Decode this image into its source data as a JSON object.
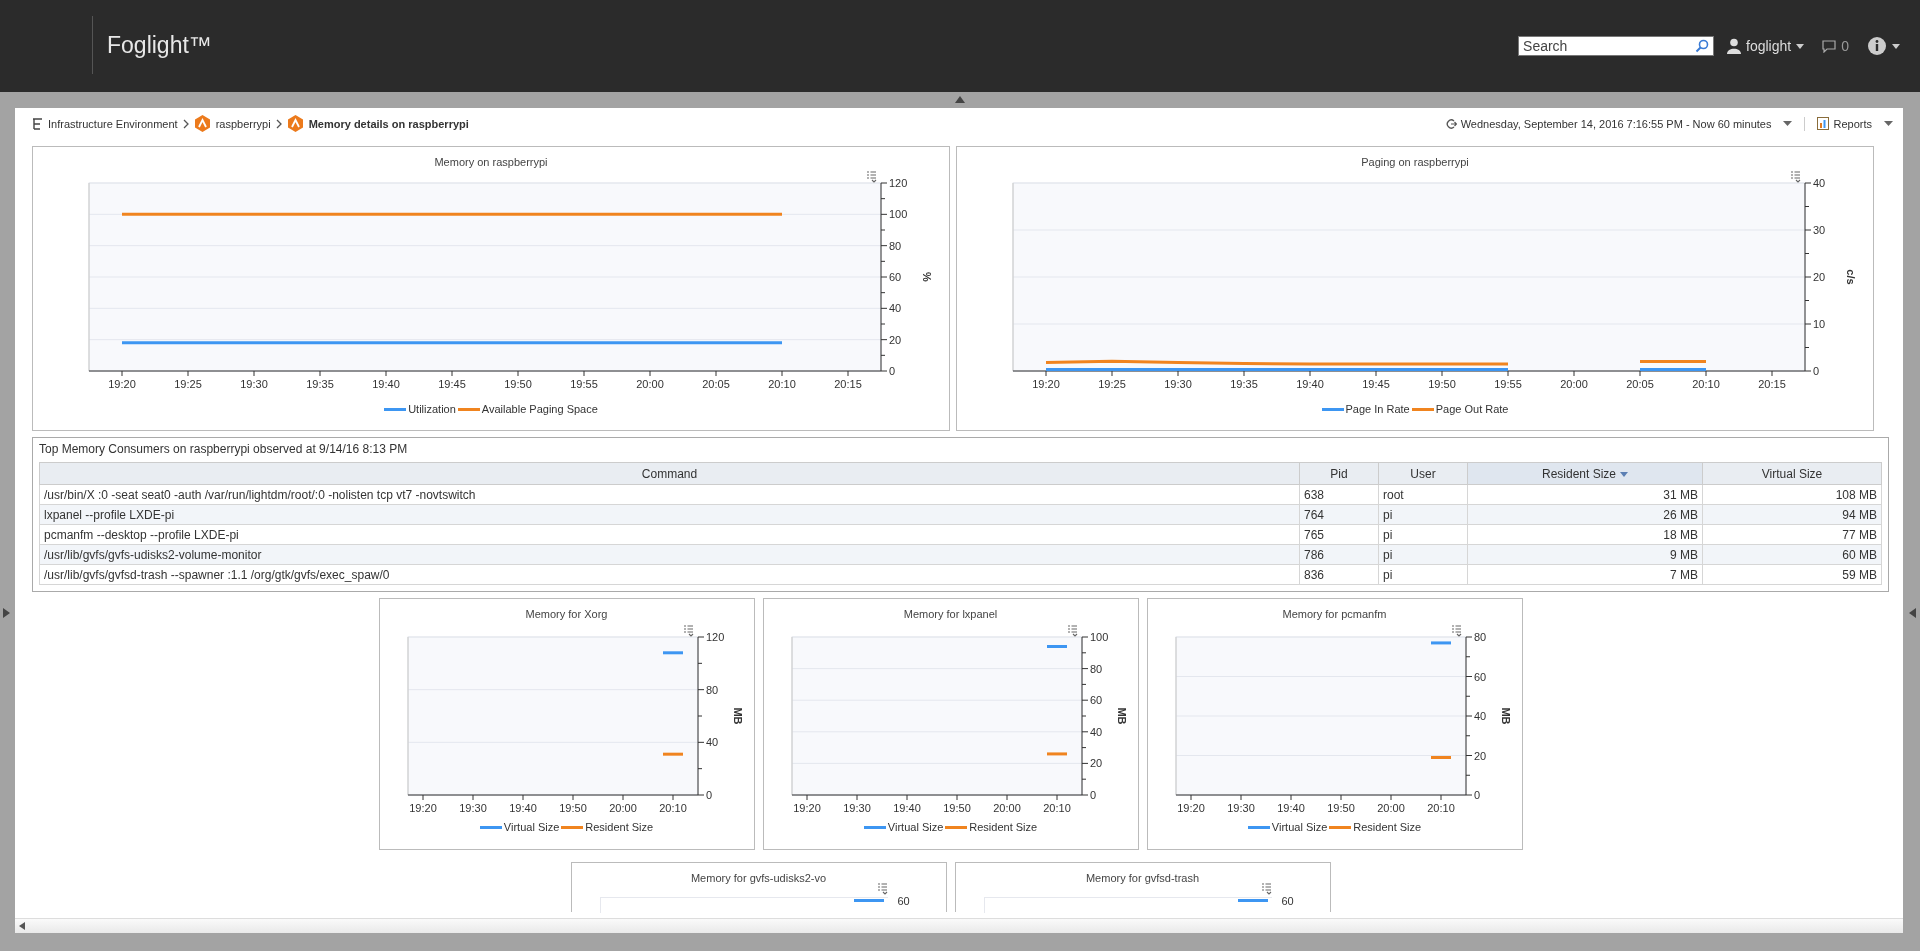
{
  "header": {
    "product": "Foglight™",
    "search": {
      "placeholder": "Search"
    },
    "user": "foglight",
    "messages": "0"
  },
  "breadcrumb": [
    {
      "label": "Infrastructure Environment",
      "kind": "root",
      "current": false
    },
    {
      "label": "raspberrypi",
      "kind": "host",
      "current": false
    },
    {
      "label": "Memory details on raspberrypi",
      "kind": "host",
      "current": true
    }
  ],
  "time_range": "Wednesday, September 14, 2016 7:16:55 PM - Now 60 minutes",
  "reports": "Reports",
  "top_charts": [
    {
      "chart_data": {
        "type": "line",
        "title": "Memory on raspberrypi",
        "ylabel": "%",
        "grid": true,
        "ylim": [
          0,
          120
        ],
        "yticks": [
          0,
          20,
          40,
          60,
          80,
          100,
          120
        ],
        "categories": [
          "19:20",
          "19:25",
          "19:30",
          "19:35",
          "19:40",
          "19:45",
          "19:50",
          "19:55",
          "20:00",
          "20:05",
          "20:10",
          "20:15"
        ],
        "series": [
          {
            "name": "Utilization",
            "color": "#3d96f2",
            "values": [
              18,
              18,
              18,
              18,
              18,
              18,
              18,
              18,
              18,
              18,
              18,
              null
            ]
          },
          {
            "name": "Available Paging Space",
            "color": "#f0841f",
            "values": [
              100,
              100,
              100,
              100,
              100,
              100,
              100,
              100,
              100,
              100,
              100,
              null
            ]
          }
        ]
      }
    },
    {
      "chart_data": {
        "type": "line",
        "title": "Paging on raspberrypi",
        "ylabel": "c/s",
        "grid": true,
        "ylim": [
          0,
          40
        ],
        "yticks": [
          0,
          10,
          20,
          30,
          40
        ],
        "categories": [
          "19:20",
          "19:25",
          "19:30",
          "19:35",
          "19:40",
          "19:45",
          "19:50",
          "19:55",
          "20:00",
          "20:05",
          "20:10",
          "20:15"
        ],
        "series": [
          {
            "name": "Page In Rate",
            "color": "#3d96f2",
            "values": [
              0.3,
              0.3,
              0.3,
              0.3,
              0.3,
              0.3,
              0.3,
              0.3,
              null,
              0.3,
              0.3,
              null
            ]
          },
          {
            "name": "Page Out Rate",
            "color": "#f0841f",
            "values": [
              1.8,
              2.1,
              1.8,
              1.6,
              1.5,
              1.5,
              1.5,
              1.5,
              null,
              2,
              2,
              null
            ]
          }
        ]
      }
    }
  ],
  "table": {
    "title": "Top Memory Consumers on raspberrypi observed at 9/14/16 8:13 PM",
    "columns": [
      {
        "label": "Command",
        "sorted": false
      },
      {
        "label": "Pid",
        "sorted": false
      },
      {
        "label": "User",
        "sorted": false
      },
      {
        "label": "Resident Size",
        "sorted": true
      },
      {
        "label": "Virtual Size",
        "sorted": false
      }
    ],
    "rows": [
      [
        "/usr/bin/X :0 -seat seat0 -auth /var/run/lightdm/root/:0 -nolisten tcp vt7 -novtswitch",
        "638",
        "root",
        "31 MB",
        "108 MB"
      ],
      [
        "lxpanel --profile LXDE-pi",
        "764",
        "pi",
        "26 MB",
        "94 MB"
      ],
      [
        "pcmanfm --desktop --profile LXDE-pi",
        "765",
        "pi",
        "18 MB",
        "77 MB"
      ],
      [
        "/usr/lib/gvfs/gvfs-udisks2-volume-monitor",
        "786",
        "pi",
        "9 MB",
        "60 MB"
      ],
      [
        "/usr/lib/gvfs/gvfsd-trash --spawner :1.1 /org/gtk/gvfs/exec_spaw/0",
        "836",
        "pi",
        "7 MB",
        "59 MB"
      ]
    ]
  },
  "process_charts": [
    {
      "chart_data": {
        "type": "line",
        "title": "Memory for Xorg",
        "ylabel": "MB",
        "grid": true,
        "ylim": [
          0,
          120
        ],
        "yticks": [
          0,
          40,
          80,
          120
        ],
        "categories": [
          null,
          "19:20",
          null,
          null,
          null,
          null,
          "19:30",
          null,
          null,
          null,
          null,
          "19:40",
          null,
          null,
          null,
          null,
          "19:50",
          null,
          null,
          null,
          null,
          "20:00",
          null,
          null,
          null,
          null,
          "20:10",
          null,
          null
        ],
        "series": [
          {
            "name": "Virtual Size",
            "color": "#3d96f2",
            "values": [
              null,
              null,
              null,
              null,
              null,
              null,
              null,
              null,
              null,
              null,
              null,
              null,
              null,
              null,
              null,
              null,
              null,
              null,
              null,
              null,
              null,
              null,
              null,
              null,
              null,
              108,
              108,
              108,
              null
            ]
          },
          {
            "name": "Resident Size",
            "color": "#f0841f",
            "values": [
              null,
              null,
              null,
              null,
              null,
              null,
              null,
              null,
              null,
              null,
              null,
              null,
              null,
              null,
              null,
              null,
              null,
              null,
              null,
              null,
              null,
              null,
              null,
              null,
              null,
              31,
              31,
              31,
              null
            ]
          }
        ]
      }
    },
    {
      "chart_data": {
        "type": "line",
        "title": "Memory for lxpanel",
        "ylabel": "MB",
        "grid": true,
        "ylim": [
          0,
          100
        ],
        "yticks": [
          0,
          20,
          40,
          60,
          80,
          100
        ],
        "categories": [
          null,
          "19:20",
          null,
          null,
          null,
          null,
          "19:30",
          null,
          null,
          null,
          null,
          "19:40",
          null,
          null,
          null,
          null,
          "19:50",
          null,
          null,
          null,
          null,
          "20:00",
          null,
          null,
          null,
          null,
          "20:10",
          null,
          null
        ],
        "series": [
          {
            "name": "Virtual Size",
            "color": "#3d96f2",
            "values": [
              null,
              null,
              null,
              null,
              null,
              null,
              null,
              null,
              null,
              null,
              null,
              null,
              null,
              null,
              null,
              null,
              null,
              null,
              null,
              null,
              null,
              null,
              null,
              null,
              null,
              94,
              94,
              94,
              null
            ]
          },
          {
            "name": "Resident Size",
            "color": "#f0841f",
            "values": [
              null,
              null,
              null,
              null,
              null,
              null,
              null,
              null,
              null,
              null,
              null,
              null,
              null,
              null,
              null,
              null,
              null,
              null,
              null,
              null,
              null,
              null,
              null,
              null,
              null,
              26,
              26,
              26,
              null
            ]
          }
        ]
      }
    },
    {
      "chart_data": {
        "type": "line",
        "title": "Memory for pcmanfm",
        "ylabel": "MB",
        "grid": true,
        "ylim": [
          0,
          80
        ],
        "yticks": [
          0,
          20,
          40,
          60,
          80
        ],
        "categories": [
          null,
          "19:20",
          null,
          null,
          null,
          null,
          "19:30",
          null,
          null,
          null,
          null,
          "19:40",
          null,
          null,
          null,
          null,
          "19:50",
          null,
          null,
          null,
          null,
          "20:00",
          null,
          null,
          null,
          null,
          "20:10",
          null,
          null
        ],
        "series": [
          {
            "name": "Virtual Size",
            "color": "#3d96f2",
            "values": [
              null,
              null,
              null,
              null,
              null,
              null,
              null,
              null,
              null,
              null,
              null,
              null,
              null,
              null,
              null,
              null,
              null,
              null,
              null,
              null,
              null,
              null,
              null,
              null,
              null,
              77,
              77,
              77,
              null
            ]
          },
          {
            "name": "Resident Size",
            "color": "#f0841f",
            "values": [
              null,
              null,
              null,
              null,
              null,
              null,
              null,
              null,
              null,
              null,
              null,
              null,
              null,
              null,
              null,
              null,
              null,
              null,
              null,
              null,
              null,
              null,
              null,
              null,
              null,
              19,
              19,
              19,
              null
            ]
          }
        ]
      }
    }
  ],
  "partial_charts": [
    {
      "title": "Memory for gvfs-udisks2-vo",
      "top_tick": "60"
    },
    {
      "title": "Memory for gvfsd-trash",
      "top_tick": "60"
    }
  ]
}
